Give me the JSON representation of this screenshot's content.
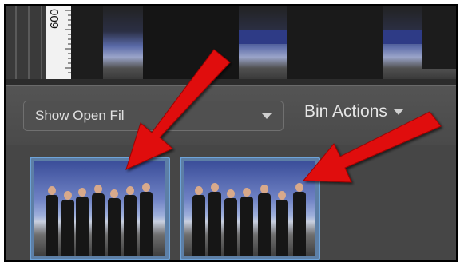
{
  "ruler": {
    "text": "600"
  },
  "toolbar": {
    "show_open_label": "Show Open Fil",
    "bin_actions_label": "Bin Actions"
  },
  "thumbnails": [
    "thumb-1",
    "thumb-2"
  ],
  "colors": {
    "panel": "#4b4b4b",
    "selection_border": "#6ea3d8",
    "arrow": "#e01010"
  },
  "icons": [
    "chevron-down-icon",
    "red-arrow-annotation"
  ]
}
